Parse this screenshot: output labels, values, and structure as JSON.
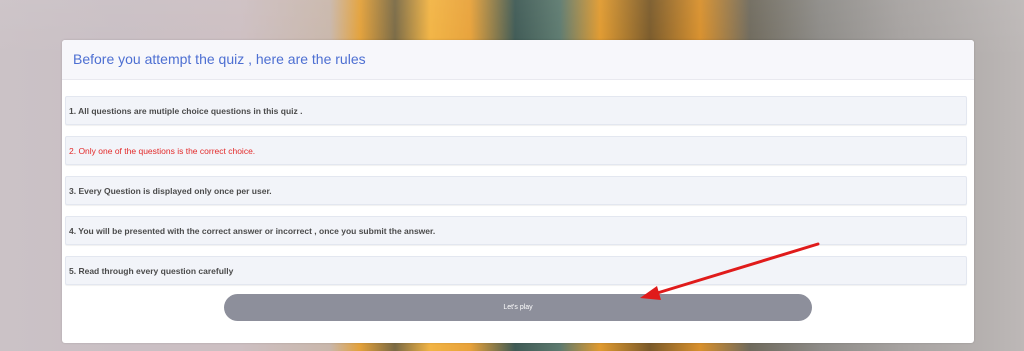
{
  "quiz": {
    "title": "Before you attempt the quiz , here are the rules",
    "rules": [
      {
        "text": "1. All questions are mutiple choice questions in this quiz ."
      },
      {
        "text": "2. Only one of the questions is the correct choice."
      },
      {
        "text": "3. Every Question is displayed only once per user."
      },
      {
        "text": "4. You will be presented with the correct answer or incorrect , once you submit the answer."
      },
      {
        "text": "5. Read through every question carefully"
      }
    ],
    "play_label": "Let's play"
  },
  "colors": {
    "title": "#4d6fd2",
    "highlight_rule": "#e32a2a",
    "button": "#8d8f9b",
    "annotation_arrow": "#e01b1b"
  },
  "icons": {
    "annotation": "red-arrow-icon"
  }
}
